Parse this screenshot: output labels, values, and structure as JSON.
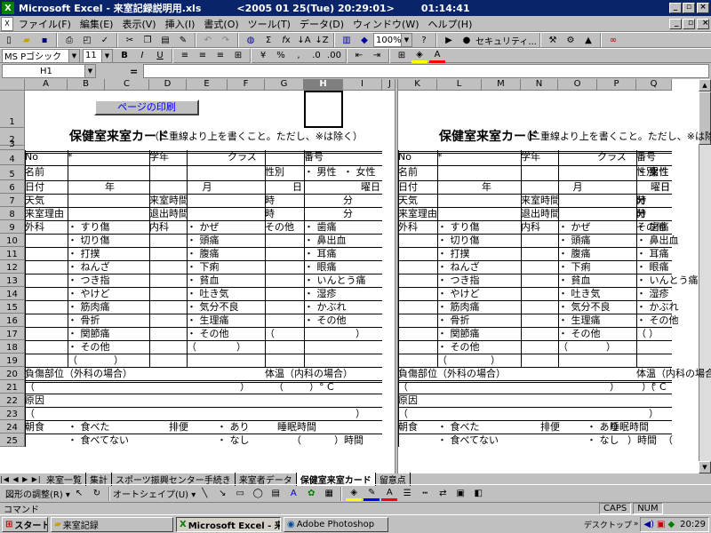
{
  "title_bar": {
    "app": "Microsoft Excel - 来室記録説明用.xls",
    "date": "<2005 01 25(Tue) 20:29:01>",
    "time": "01:14:41"
  },
  "menu": [
    "ファイル(F)",
    "編集(E)",
    "表示(V)",
    "挿入(I)",
    "書式(O)",
    "ツール(T)",
    "データ(D)",
    "ウィンドウ(W)",
    "ヘルプ(H)"
  ],
  "toolbar": {
    "zoom": "100%",
    "security_label": "セキュリティ..."
  },
  "format": {
    "font": "MS Pゴシック",
    "size": "11",
    "bold": "B",
    "italic": "I",
    "underline": "U"
  },
  "formula_bar": {
    "name_box": "H1",
    "equals": "="
  },
  "columns_left": [
    "A",
    "B",
    "C",
    "D",
    "E",
    "F",
    "G",
    "H",
    "I",
    "J"
  ],
  "columns_right": [
    "K",
    "L",
    "M",
    "N",
    "O",
    "P",
    "Q"
  ],
  "rows": [
    "1",
    "2",
    "3",
    "4",
    "5",
    "6",
    "7",
    "8",
    "9",
    "10",
    "11",
    "12",
    "13",
    "14",
    "15",
    "16",
    "17",
    "18",
    "19",
    "20",
    "21",
    "22",
    "23",
    "24",
    "25"
  ],
  "print_button": "ページの印刷",
  "form": {
    "title": "保健室来室カード",
    "note": "（二重線より上を書くこと。ただし、※は除く）",
    "r4": {
      "no": "No",
      "star": "*",
      "grade": "学年",
      "class": "クラス",
      "number": "番号"
    },
    "r5": {
      "name": "名前",
      "sex": "性別",
      "male": "・ 男性",
      "female": "・ 女性"
    },
    "r6": {
      "date": "日付",
      "year": "年",
      "month": "月",
      "day": "日",
      "weekday": "曜日"
    },
    "r7": {
      "weather": "天気",
      "arrive": "来室時間",
      "hour": "時",
      "min": "分"
    },
    "r8": {
      "reason": "来室理由",
      "leave": "退出時間",
      "hour": "時",
      "min": "分"
    },
    "cat_surgery": "外科",
    "cat_internal": "内科",
    "cat_other": "その他",
    "surgery": [
      "・ すり傷",
      "・ 切り傷",
      "・ 打撲",
      "・ ねんざ",
      "・ つき指",
      "・ やけど",
      "・ 筋肉痛",
      "・ 骨折",
      "・ 関節痛",
      "・ その他"
    ],
    "internal": [
      "・ かぜ",
      "・ 頭痛",
      "・ 腹痛",
      "・ 下痢",
      "・ 貧血",
      "・ 吐き気",
      "・ 気分不良",
      "・ 生理痛",
      "・ その他"
    ],
    "other": [
      "・ 歯痛",
      "・ 鼻出血",
      "・ 耳痛",
      "・ 眼痛",
      "・ いんとう痛",
      "・ 湿疹",
      "・ かぶれ",
      "・ その他"
    ],
    "paren_open": "（",
    "paren_close": "）",
    "injury": "負傷部位（外科の場合）",
    "temp": "体温（内科の場合）",
    "temp_unit": "）° C",
    "cause": "原因",
    "breakfast": "朝食",
    "ate": "・ 食べた",
    "not_ate": "・ 食べてない",
    "bowel": "排便",
    "yes": "・ あり",
    "no": "・ なし",
    "sleep": "睡眠時間",
    "hours_suffix": "）時間"
  },
  "sheet_tabs": [
    "来室一覧",
    "集計",
    "スポーツ振興センター手続き",
    "来室者データ",
    "保健室来室カード",
    "留意点"
  ],
  "drawbar": {
    "draw": "図形の調整(R) ▾",
    "autoshape": "オートシェイプ(U) ▾"
  },
  "status": {
    "mode": "コマンド",
    "caps": "CAPS",
    "num": "NUM"
  },
  "taskbar": {
    "start": "スタート",
    "items": [
      "来室記録",
      "Microsoft Excel - 来...",
      "Adobe Photoshop"
    ],
    "desktop": "デスクトップ",
    "clock": "20:29"
  }
}
